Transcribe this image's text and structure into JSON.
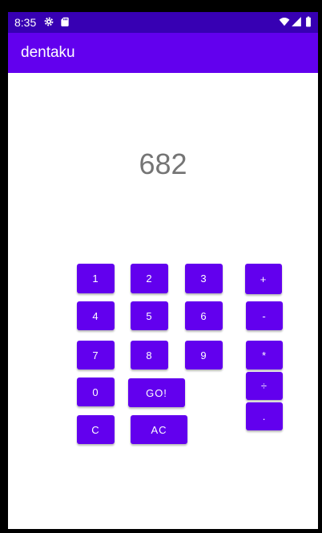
{
  "status_bar": {
    "time": "8:35",
    "left_icons": [
      "settings-icon",
      "sd-card-icon"
    ],
    "right_icons": [
      "wifi-icon",
      "signal-icon",
      "battery-icon"
    ]
  },
  "app_bar": {
    "title": "dentaku"
  },
  "display": {
    "value": "682"
  },
  "keys": {
    "one": "1",
    "two": "2",
    "three": "3",
    "four": "4",
    "five": "5",
    "six": "6",
    "seven": "7",
    "eight": "8",
    "nine": "9",
    "zero": "0",
    "go": "GO!",
    "clear": "C",
    "all_clear": "AC",
    "plus": "+",
    "minus": "-",
    "multiply": "*",
    "divide": "÷",
    "dot": "."
  },
  "colors": {
    "primary": "#6200ee",
    "primary_dark": "#3700b3",
    "display_text": "#757575"
  }
}
